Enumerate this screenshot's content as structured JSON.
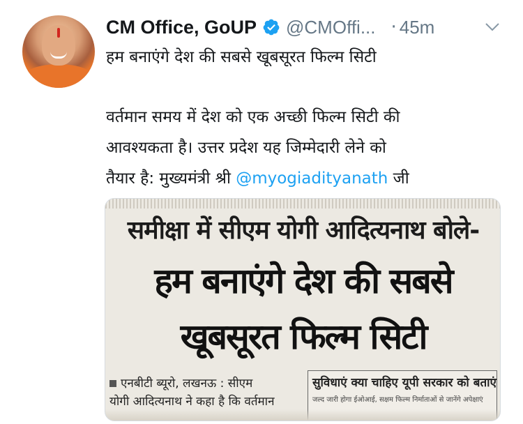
{
  "tweet": {
    "author_name": "CM Office, GoUP",
    "handle": "@CMOffi...",
    "separator": "·",
    "time": "45m",
    "line1": "हम बनाएंगे देश की सबसे खूबसूरत फिल्म सिटी",
    "para_line1": "वर्तमान समय में देश को एक अच्छी फिल्म सिटी की",
    "para_line2": "आवश्यकता है। उत्तर प्रदेश यह जिम्मेदारी लेने को",
    "para_line3_prefix": "तैयार है: मुख्यमंत्री श्री ",
    "mention": "@myogiadityanath",
    "para_line3_suffix": " जी"
  },
  "media": {
    "headline_small": "समीक्षा में सीएम योगी आदित्यनाथ बोले-",
    "headline_big_1": "हम बनाएंगे देश की सबसे",
    "headline_big_2": "खूबसूरत फिल्म सिटी",
    "body_line1": "एनबीटी ब्यूरो, लखनऊ : सीएम",
    "body_line2": "योगी आदित्यनाथ ने कहा है कि वर्तमान",
    "box_title": "सुविधाएं क्या चाहिए यूपी सरकार को बताएं",
    "box_sub": "जल्द जारी होगा ईओआई, सक्षम फिल्म निर्माताओं से जानेंगे अपेक्षाएं"
  },
  "icons": {
    "verified": "verified-badge-icon",
    "menu": "chevron-down-icon"
  },
  "colors": {
    "name": "#14171a",
    "secondary": "#657786",
    "link": "#1da1f2",
    "verified": "#1da1f2"
  }
}
